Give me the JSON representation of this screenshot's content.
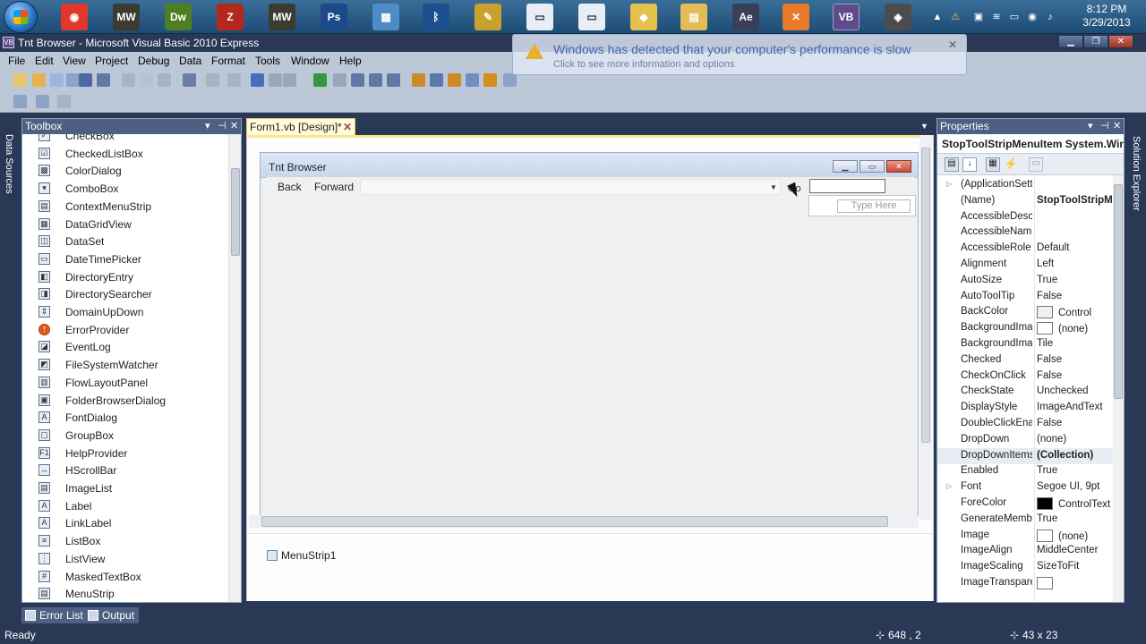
{
  "taskbar": {
    "icons": [
      {
        "name": "chrome-icon",
        "glyph": "◉",
        "color": "#e2372c"
      },
      {
        "name": "mw-icon",
        "glyph": "MW",
        "color": "#3b3b30"
      },
      {
        "name": "dreamweaver-icon",
        "glyph": "Dw",
        "color": "#4d7f22"
      },
      {
        "name": "filezilla-icon",
        "glyph": "Z",
        "color": "#b3271c"
      },
      {
        "name": "mw-icon-2",
        "glyph": "MW",
        "color": "#3b3b30"
      },
      {
        "name": "photoshop-icon",
        "glyph": "Ps",
        "color": "#1b4a8a"
      },
      {
        "name": "network-icon",
        "glyph": "▦",
        "color": "#4f8cc7"
      },
      {
        "name": "bluetooth-icon",
        "glyph": "ᛒ",
        "color": "#1b4f90"
      },
      {
        "name": "paint-icon",
        "glyph": "✎",
        "color": "#c8a22c"
      },
      {
        "name": "window-icon",
        "glyph": "▭",
        "color": "#e9eef6"
      },
      {
        "name": "window-icon-2",
        "glyph": "▭",
        "color": "#e9eef6"
      },
      {
        "name": "folder-icon",
        "glyph": "◆",
        "color": "#e4c04d"
      },
      {
        "name": "explorer-icon",
        "glyph": "▤",
        "color": "#e3bb57"
      },
      {
        "name": "aftereffects-icon",
        "glyph": "Ae",
        "color": "#3b3e58"
      },
      {
        "name": "xampp-icon",
        "glyph": "✕",
        "color": "#e8792b"
      },
      {
        "name": "visualbasic-icon",
        "glyph": "VB",
        "color": "#5f4b8b"
      },
      {
        "name": "media-icon",
        "glyph": "◈",
        "color": "#4c4c4c"
      }
    ],
    "clock_time": "8:12 PM",
    "clock_date": "3/29/2013"
  },
  "window": {
    "title": "Tnt Browser - Microsoft Visual Basic 2010 Express"
  },
  "notification": {
    "title": "Windows has detected that your computer's performance is slow",
    "subtitle": "Click to see more information and options"
  },
  "menu": [
    "File",
    "Edit",
    "View",
    "Project",
    "Debug",
    "Data",
    "Format",
    "Tools",
    "Window",
    "Help"
  ],
  "side": {
    "left": "Data Sources",
    "right": "Solution Explorer"
  },
  "toolbox": {
    "title": "Toolbox",
    "items": [
      {
        "label": "CheckBox",
        "icon": "✓"
      },
      {
        "label": "CheckedListBox",
        "icon": "☑"
      },
      {
        "label": "ColorDialog",
        "icon": "▩"
      },
      {
        "label": "ComboBox",
        "icon": "▾"
      },
      {
        "label": "ContextMenuStrip",
        "icon": "▤"
      },
      {
        "label": "DataGridView",
        "icon": "▦"
      },
      {
        "label": "DataSet",
        "icon": "◫"
      },
      {
        "label": "DateTimePicker",
        "icon": "▭"
      },
      {
        "label": "DirectoryEntry",
        "icon": "◧"
      },
      {
        "label": "DirectorySearcher",
        "icon": "◨"
      },
      {
        "label": "DomainUpDown",
        "icon": "⇕"
      },
      {
        "label": "ErrorProvider",
        "icon": "!"
      },
      {
        "label": "EventLog",
        "icon": "◪"
      },
      {
        "label": "FileSystemWatcher",
        "icon": "◩"
      },
      {
        "label": "FlowLayoutPanel",
        "icon": "▥"
      },
      {
        "label": "FolderBrowserDialog",
        "icon": "▣"
      },
      {
        "label": "FontDialog",
        "icon": "A"
      },
      {
        "label": "GroupBox",
        "icon": "▢"
      },
      {
        "label": "HelpProvider",
        "icon": "F1"
      },
      {
        "label": "HScrollBar",
        "icon": "↔"
      },
      {
        "label": "ImageList",
        "icon": "▤"
      },
      {
        "label": "Label",
        "icon": "A"
      },
      {
        "label": "LinkLabel",
        "icon": "A"
      },
      {
        "label": "ListBox",
        "icon": "≡"
      },
      {
        "label": "ListView",
        "icon": "⋮"
      },
      {
        "label": "MaskedTextBox",
        "icon": "#"
      },
      {
        "label": "MenuStrip",
        "icon": "▤"
      }
    ]
  },
  "designer": {
    "tab": "Form1.vb [Design]*",
    "form_title": "Tnt Browser",
    "menu_items": [
      "Back",
      "Forward"
    ],
    "go_label": "Go",
    "type_here": "Type Here",
    "tray_component": "MenuStrip1"
  },
  "properties": {
    "title": "Properties",
    "selected_object": "StopToolStripMenuItem System.Windows.Forms.ToolStripMenuItem",
    "rows": [
      {
        "name": "(ApplicationSett",
        "value": "",
        "expand": true
      },
      {
        "name": "(Name)",
        "value": "StopToolStripMenuItem",
        "bold": true
      },
      {
        "name": "AccessibleDescri",
        "value": ""
      },
      {
        "name": "AccessibleName",
        "value": ""
      },
      {
        "name": "AccessibleRole",
        "value": "Default"
      },
      {
        "name": "Alignment",
        "value": "Left"
      },
      {
        "name": "AutoSize",
        "value": "True"
      },
      {
        "name": "AutoToolTip",
        "value": "False"
      },
      {
        "name": "BackColor",
        "value": "Control",
        "swatch": "#f0f0f0"
      },
      {
        "name": "BackgroundImag",
        "value": "(none)",
        "swatch": "#ffffff"
      },
      {
        "name": "BackgroundImag",
        "value": "Tile"
      },
      {
        "name": "Checked",
        "value": "False"
      },
      {
        "name": "CheckOnClick",
        "value": "False"
      },
      {
        "name": "CheckState",
        "value": "Unchecked"
      },
      {
        "name": "DisplayStyle",
        "value": "ImageAndText"
      },
      {
        "name": "DoubleClickEnal",
        "value": "False"
      },
      {
        "name": "DropDown",
        "value": "(none)"
      },
      {
        "name": "DropDownItems",
        "value": "(Collection)",
        "bold": true
      },
      {
        "name": "Enabled",
        "value": "True"
      },
      {
        "name": "Font",
        "value": "Segoe UI, 9pt",
        "expand": true
      },
      {
        "name": "ForeColor",
        "value": "ControlText",
        "swatch": "#000000"
      },
      {
        "name": "GenerateMembe",
        "value": "True"
      },
      {
        "name": "Image",
        "value": "(none)",
        "swatch": "#ffffff"
      },
      {
        "name": "ImageAlign",
        "value": "MiddleCenter"
      },
      {
        "name": "ImageScaling",
        "value": "SizeToFit"
      },
      {
        "name": "ImageTranspare",
        "value": "",
        "swatch": "#ffffff"
      }
    ]
  },
  "bottom_tabs": [
    "Error List",
    "Output"
  ],
  "status": {
    "ready": "Ready",
    "position": "648 , 2",
    "size": "43 x 23"
  }
}
